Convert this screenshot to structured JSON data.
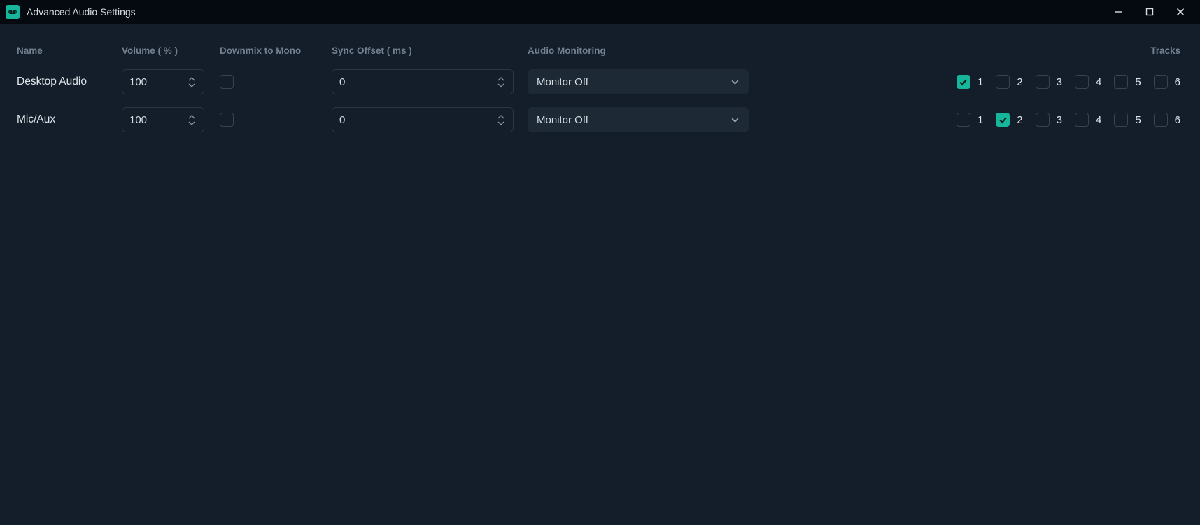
{
  "window": {
    "title": "Advanced Audio Settings"
  },
  "columns": {
    "name": "Name",
    "volume": "Volume ( % )",
    "downmix": "Downmix to Mono",
    "sync_offset": "Sync Offset ( ms )",
    "audio_monitoring": "Audio Monitoring",
    "tracks": "Tracks"
  },
  "track_labels": [
    "1",
    "2",
    "3",
    "4",
    "5",
    "6"
  ],
  "sources": [
    {
      "name": "Desktop Audio",
      "volume": "100",
      "downmix": false,
      "sync_offset": "0",
      "monitoring": "Monitor Off",
      "tracks": [
        true,
        false,
        false,
        false,
        false,
        false
      ]
    },
    {
      "name": "Mic/Aux",
      "volume": "100",
      "downmix": false,
      "sync_offset": "0",
      "monitoring": "Monitor Off",
      "tracks": [
        false,
        true,
        false,
        false,
        false,
        false
      ]
    }
  ]
}
